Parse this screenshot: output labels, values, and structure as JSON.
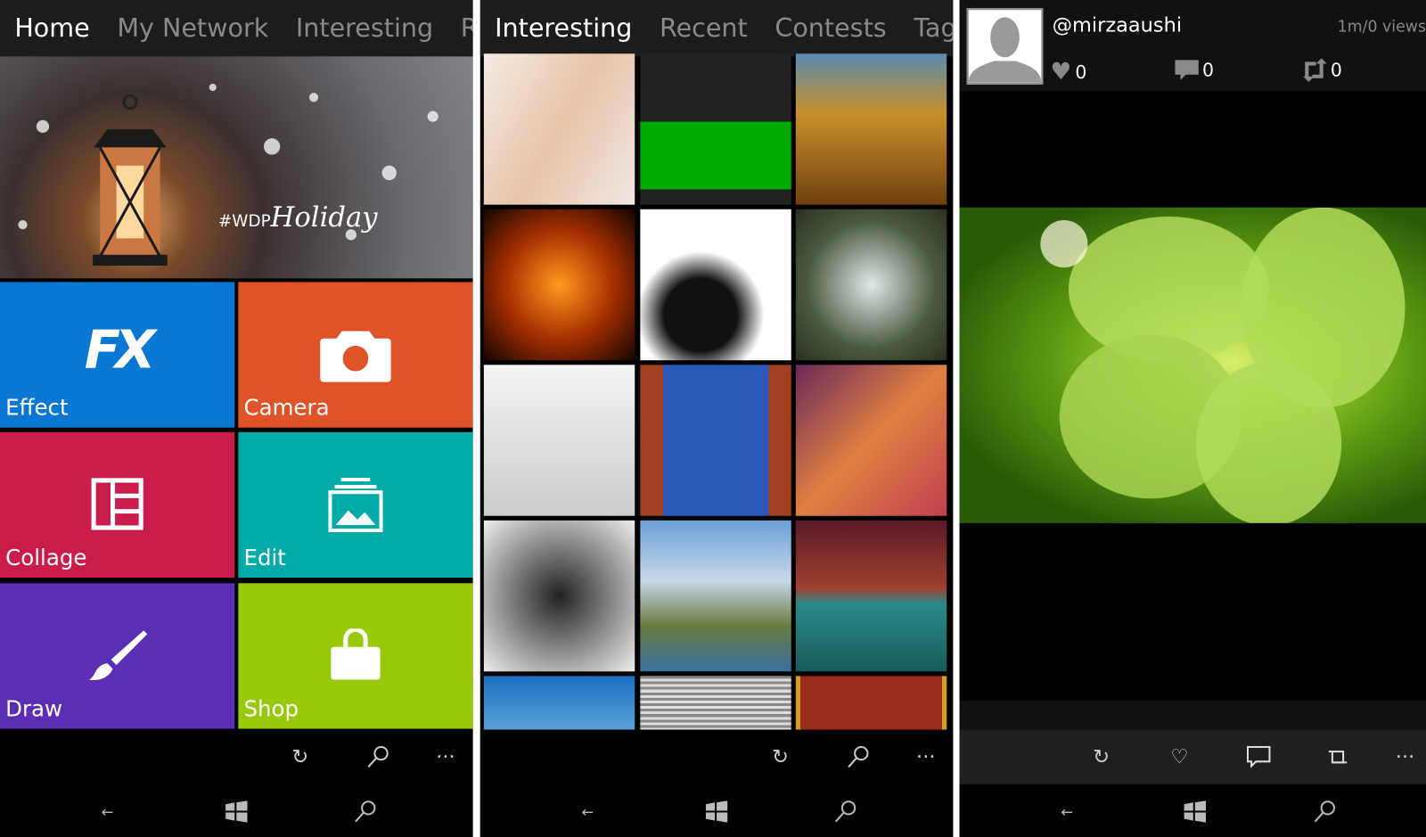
{
  "panel_home": {
    "pivot": [
      "Home",
      "My Network",
      "Interesting",
      "Recent"
    ],
    "hero": {
      "hashtag": "#WDP",
      "script_text": "Holiday"
    },
    "tiles": [
      {
        "label": "Effect",
        "color": "#0a78d2",
        "icon": "fx-icon"
      },
      {
        "label": "Camera",
        "color": "#e05328",
        "icon": "camera-icon"
      },
      {
        "label": "Collage",
        "color": "#c91c4a",
        "icon": "collage-icon"
      },
      {
        "label": "Edit",
        "color": "#00aaa8",
        "icon": "image-edit-icon"
      },
      {
        "label": "Draw",
        "color": "#5c2eb3",
        "icon": "brush-icon"
      },
      {
        "label": "Shop",
        "color": "#98c80a",
        "icon": "shopping-bag-icon"
      }
    ],
    "appbar": [
      "refresh-icon",
      "search-icon",
      "more-icon"
    ]
  },
  "panel_interesting": {
    "pivot": [
      "Interesting",
      "Recent",
      "Contests",
      "Tags"
    ],
    "appbar": [
      "refresh-icon",
      "search-icon",
      "more-icon"
    ]
  },
  "panel_detail": {
    "username": "@mirzaaushi",
    "views": "1m/0 views",
    "likes": "0",
    "comments": "0",
    "reposts": "0",
    "appbar": [
      "refresh-icon",
      "heart-icon",
      "comment-icon",
      "repost-icon",
      "more-icon"
    ]
  },
  "more_label": "···",
  "colors": {
    "bar": "#1c1c1c",
    "appbar_detail": "#1f1f1f"
  }
}
